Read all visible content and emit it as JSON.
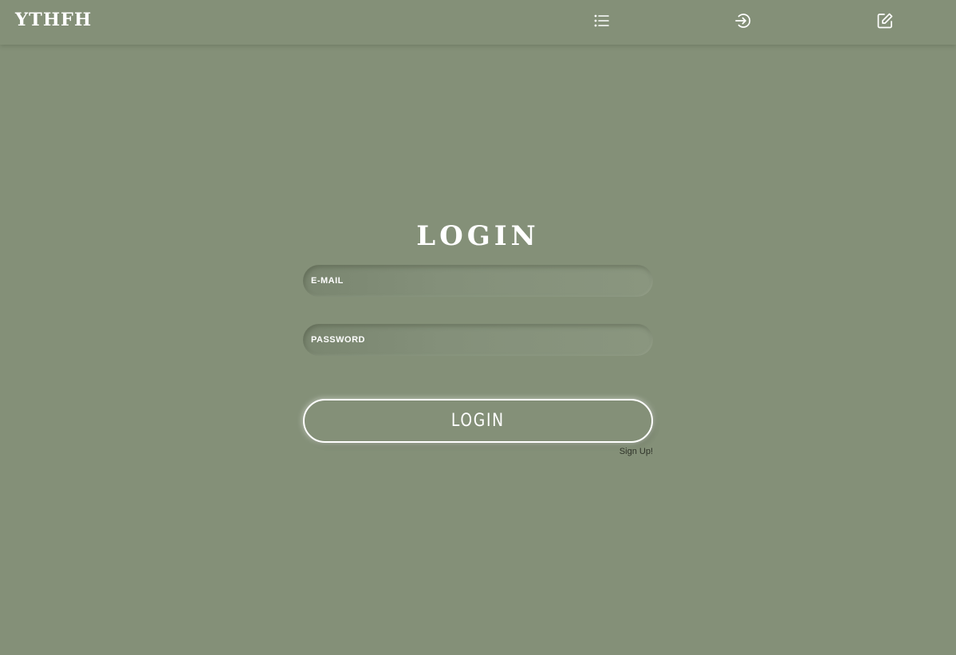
{
  "header": {
    "logo_text": "YTHFH",
    "nav": [
      {
        "icon": "list-icon"
      },
      {
        "icon": "login-icon"
      },
      {
        "icon": "edit-icon"
      }
    ]
  },
  "login": {
    "title": "LOGIN",
    "email_placeholder": "E-MAIL",
    "password_placeholder": "PASSWORD",
    "button_label": "LOGIN",
    "signup_label": "Sign Up!"
  },
  "colors": {
    "background": "#849078",
    "text": "#ffffff",
    "link": "#2f3329"
  }
}
